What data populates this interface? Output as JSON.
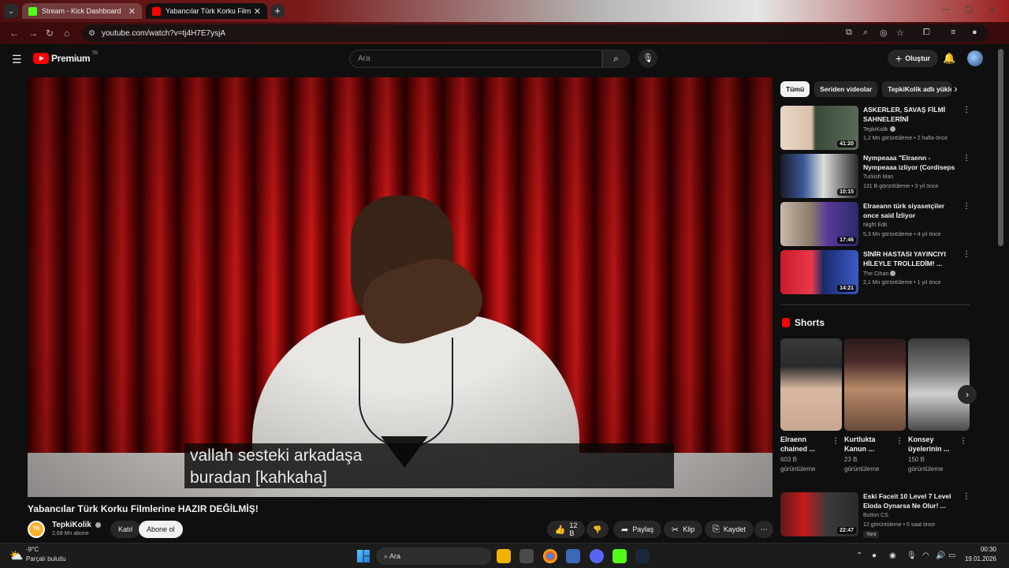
{
  "browser": {
    "tabs": [
      {
        "title": "Stream - Kick Dashboard",
        "active": false,
        "favicon_color": "#53fc18"
      },
      {
        "title": "Yabancılar Türk Korku Filmlerine",
        "active": true,
        "favicon_color": "#ff0000"
      }
    ],
    "url": "youtube.com/watch?v=tj4H7E7ysjA"
  },
  "youtube": {
    "brand": "Premium",
    "country_code": "TR",
    "search_placeholder": "Ara",
    "create_label": "Oluştur"
  },
  "player": {
    "caption_line1": "vallah sesteki arkadaşa",
    "caption_line2": "buradan [kahkaha]"
  },
  "video": {
    "title": "Yabancılar Türk Korku Filmlerine HAZIR DEĞİLMİŞ!",
    "channel": "TepkiKolik",
    "channel_initials": "TK",
    "subscribers": "2,68 Mn abone",
    "join_label": "Katıl",
    "subscribe_label": "Abone ol",
    "likes": "12 B",
    "share_label": "Paylaş",
    "clip_label": "Klip",
    "save_label": "Kaydet"
  },
  "chips": [
    "Tümü",
    "Seriden videolar",
    "TepkiKolik adlı yükle"
  ],
  "recommendations": [
    {
      "title": "ASKERLER, SAVAŞ FİLMİ SAHNELERİNİ YORUMLUYOR!",
      "channel": "TepkiKolik",
      "verified": true,
      "meta": "1,2 Mn görüntüleme • 2 hafta önce",
      "duration": "41:20"
    },
    {
      "title": "Nympeaaa \"Elraenn - Nympeaaa izliyor (Cordiseps yayında ...",
      "channel": "Turkish Man",
      "verified": false,
      "meta": "131 B görüntüleme • 3 yıl önce",
      "duration": "10:15"
    },
    {
      "title": "Elraeann türk siyasetçiler once said İzliyor",
      "channel": "Night Edit",
      "verified": false,
      "meta": "5,3 Mn görüntüleme • 4 yıl önce",
      "duration": "17:46"
    },
    {
      "title": "SİNİR HASTASI YAYINCIYI HİLEYLE TROLLEDİM! ...",
      "channel": "The Cihan",
      "verified": true,
      "meta": "2,1 Mn görüntüleme • 1 yıl önce",
      "duration": "14:21"
    }
  ],
  "shorts": {
    "heading": "Shorts",
    "items": [
      {
        "title": "Elraenn chained ...",
        "views": "603 B görüntüleme"
      },
      {
        "title": "Kurtlukta Kanun ...",
        "views": "23 B görüntüleme"
      },
      {
        "title": "Konsey üyelerinin ...",
        "views": "150 B görüntüleme"
      }
    ]
  },
  "recommendation_5": {
    "title": "Eski Faceit 10 Level 7 Level Eloda Oynarsa Ne Olur! ...",
    "channel": "Button CS",
    "meta": "12 görüntüleme • 5 saat önce",
    "duration": "22:47",
    "badge": "Yeni"
  },
  "taskbar": {
    "temperature": "-9°C",
    "condition": "Parçalı bulutlu",
    "search_label": "Ara",
    "time": "00:30",
    "date": "19.01.2026"
  }
}
